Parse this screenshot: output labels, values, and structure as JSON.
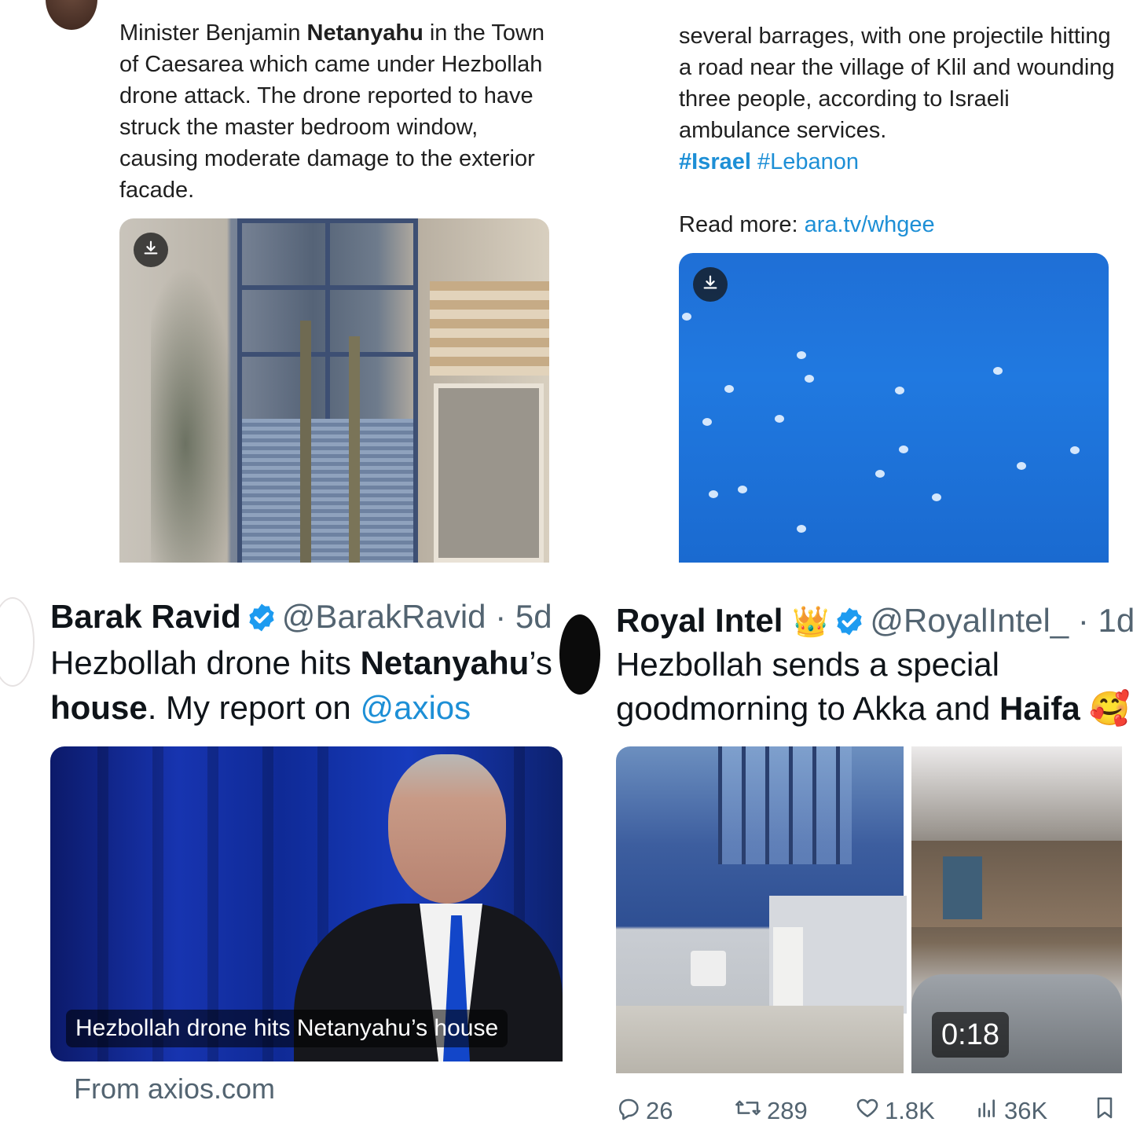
{
  "top_left": {
    "text_1": "Minister Benjamin ",
    "text_bold": "Netanyahu",
    "text_2": " in the Town of Caesarea which came under Hezbollah drone attack. The drone reported to have struck the master bedroom window, causing moderate damage to the exterior facade."
  },
  "top_right": {
    "text": "several barrages, with one projectile hitting a road near the village of Klil and wounding three people, according to Israeli ambulance services.",
    "hashtag_1": "#Israel",
    "hashtag_2": "#Lebanon",
    "read_more_label": "Read more: ",
    "read_more_link": "ara.tv/whgee"
  },
  "bottom_left": {
    "name": "Barak Ravid",
    "handle": "@BarakRavid",
    "separator": " · ",
    "time": "5d",
    "body_1": "Hezbollah drone hits ",
    "body_bold_1": "Netanyahu",
    "body_2": "’s ",
    "body_bold_2": "house",
    "body_3": ". My report on ",
    "mention": "@axios",
    "card_caption": "Hezbollah drone hits Netanyahu’s house",
    "card_source": "From axios.com"
  },
  "bottom_right": {
    "name": "Royal Intel",
    "crown_emoji": "👑",
    "handle": "@RoyalIntel_",
    "separator": " · ",
    "time": "1d",
    "body_1": "Hezbollah sends a special goodmorning to Akka and ",
    "body_bold": "Haifa",
    "body_emoji": "🥰",
    "video_duration": "0:18",
    "replies": "26",
    "reposts": "289",
    "likes": "1.8K",
    "views": "36K"
  },
  "colors": {
    "link": "#1d8fd6",
    "verified": "#1d9bf0",
    "secondary_text": "#536471"
  }
}
